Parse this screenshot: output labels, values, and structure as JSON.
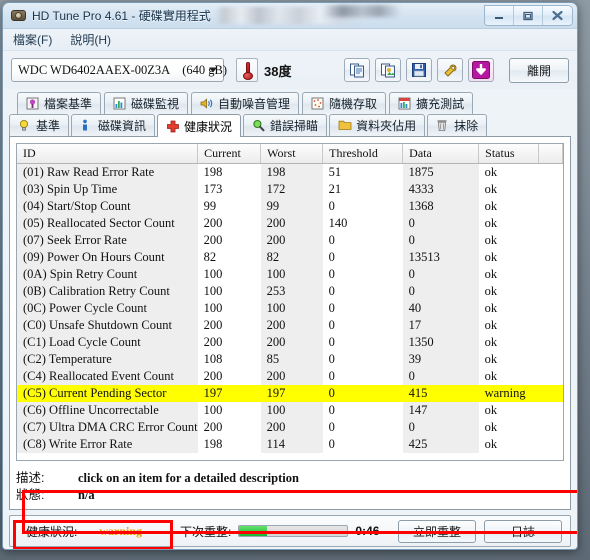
{
  "window": {
    "title": "HD Tune Pro 4.61 - 硬碟實用程式",
    "app_icon": "harddisk-icon",
    "controls": {
      "minimize": "minimize-icon",
      "maximize": "maximize-icon",
      "close": "close-icon"
    }
  },
  "menu": [
    {
      "label": "檔案(F)",
      "name": "menu-file"
    },
    {
      "label": "說明(H)",
      "name": "menu-help"
    }
  ],
  "toolbar": {
    "drive_name": "WDC WD6402AAEX-00Z3A",
    "drive_capacity": "(640 gB)",
    "temperature": "38度",
    "thermometer_icon": "thermometer-icon",
    "buttons": [
      {
        "name": "copy-icon"
      },
      {
        "name": "copy-image-icon"
      },
      {
        "name": "save-icon"
      },
      {
        "name": "settings-icon"
      },
      {
        "name": "download-icon"
      }
    ],
    "exit_label": "離開"
  },
  "tabs": {
    "row1": [
      {
        "label": "檔案基準",
        "icon": "file-benchmark-icon",
        "active": false
      },
      {
        "label": "磁碟監視",
        "icon": "disk-monitor-icon",
        "active": false
      },
      {
        "label": "自動噪音管理",
        "icon": "aam-speaker-icon",
        "active": false
      },
      {
        "label": "隨機存取",
        "icon": "random-access-icon",
        "active": false
      },
      {
        "label": "擴充測試",
        "icon": "extra-tests-icon",
        "active": false
      }
    ],
    "row2": [
      {
        "label": "基準",
        "icon": "benchmark-bulb-icon",
        "active": false
      },
      {
        "label": "磁碟資訊",
        "icon": "info-icon",
        "active": false
      },
      {
        "label": "健康狀況",
        "icon": "health-cross-icon",
        "active": true
      },
      {
        "label": "錯誤掃瞄",
        "icon": "error-scan-magnifier-icon",
        "active": false
      },
      {
        "label": "資料夾佔用",
        "icon": "folder-usage-icon",
        "active": false
      },
      {
        "label": "抹除",
        "icon": "erase-trash-icon",
        "active": false
      }
    ]
  },
  "table": {
    "columns": [
      "ID",
      "Current",
      "Worst",
      "Threshold",
      "Data",
      "Status"
    ],
    "rows": [
      {
        "id": "(01) Raw Read Error Rate",
        "current": "198",
        "worst": "198",
        "threshold": "51",
        "data": "1875",
        "status": "ok",
        "warn": false
      },
      {
        "id": "(03) Spin Up Time",
        "current": "173",
        "worst": "172",
        "threshold": "21",
        "data": "4333",
        "status": "ok",
        "warn": false
      },
      {
        "id": "(04) Start/Stop Count",
        "current": "99",
        "worst": "99",
        "threshold": "0",
        "data": "1368",
        "status": "ok",
        "warn": false
      },
      {
        "id": "(05) Reallocated Sector Count",
        "current": "200",
        "worst": "200",
        "threshold": "140",
        "data": "0",
        "status": "ok",
        "warn": false
      },
      {
        "id": "(07) Seek Error Rate",
        "current": "200",
        "worst": "200",
        "threshold": "0",
        "data": "0",
        "status": "ok",
        "warn": false
      },
      {
        "id": "(09) Power On Hours Count",
        "current": "82",
        "worst": "82",
        "threshold": "0",
        "data": "13513",
        "status": "ok",
        "warn": false
      },
      {
        "id": "(0A) Spin Retry Count",
        "current": "100",
        "worst": "100",
        "threshold": "0",
        "data": "0",
        "status": "ok",
        "warn": false
      },
      {
        "id": "(0B) Calibration Retry Count",
        "current": "100",
        "worst": "253",
        "threshold": "0",
        "data": "0",
        "status": "ok",
        "warn": false
      },
      {
        "id": "(0C) Power Cycle Count",
        "current": "100",
        "worst": "100",
        "threshold": "0",
        "data": "40",
        "status": "ok",
        "warn": false
      },
      {
        "id": "(C0) Unsafe Shutdown Count",
        "current": "200",
        "worst": "200",
        "threshold": "0",
        "data": "17",
        "status": "ok",
        "warn": false
      },
      {
        "id": "(C1) Load Cycle Count",
        "current": "200",
        "worst": "200",
        "threshold": "0",
        "data": "1350",
        "status": "ok",
        "warn": false
      },
      {
        "id": "(C2) Temperature",
        "current": "108",
        "worst": "85",
        "threshold": "0",
        "data": "39",
        "status": "ok",
        "warn": false
      },
      {
        "id": "(C4) Reallocated Event Count",
        "current": "200",
        "worst": "200",
        "threshold": "0",
        "data": "0",
        "status": "ok",
        "warn": false
      },
      {
        "id": "(C5) Current Pending Sector",
        "current": "197",
        "worst": "197",
        "threshold": "0",
        "data": "415",
        "status": "warning",
        "warn": true
      },
      {
        "id": "(C6) Offline Uncorrectable",
        "current": "100",
        "worst": "100",
        "threshold": "0",
        "data": "147",
        "status": "ok",
        "warn": false
      },
      {
        "id": "(C7) Ultra DMA CRC Error Count",
        "current": "200",
        "worst": "200",
        "threshold": "0",
        "data": "0",
        "status": "ok",
        "warn": false
      },
      {
        "id": "(C8) Write Error Rate",
        "current": "198",
        "worst": "114",
        "threshold": "0",
        "data": "425",
        "status": "ok",
        "warn": false
      }
    ]
  },
  "description": {
    "desc_label": "描述:",
    "desc_value": "click on an item for a detailed description",
    "state_label": "狀態:",
    "state_value": "n/a"
  },
  "statusbar": {
    "health_label": "健康狀況:",
    "health_value": "warning",
    "refresh_label": "下次重整:",
    "progress_percent": 26,
    "time": "0:46",
    "refresh_now_label": "立即重整",
    "log_label": "日誌"
  },
  "annotations": {
    "highlight_color": "#ff0000",
    "warning_row_color": "#ffff00",
    "warning_text_color": "#e8a000"
  }
}
